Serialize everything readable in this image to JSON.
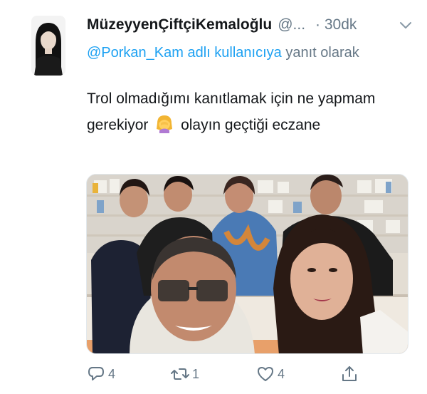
{
  "tweet": {
    "author_name": "MüzeyyenÇiftçiKemaloğlu",
    "handle": "@...",
    "time": "· 30dk",
    "reply_prefix": "@Porkan_Kam adlı kullanıcıya",
    "reply_suffix": " yanıt olarak",
    "text_part1": "Trol olmadığımı kanıtlamak için ne yapmam gerekiyor",
    "text_part2": " olayın geçtiği eczane"
  },
  "actions": {
    "reply_count": "4",
    "retweet_count": "1",
    "like_count": "4"
  },
  "colors": {
    "accent": "#1da1f2",
    "muted": "#657786",
    "text": "#14171a"
  },
  "icons": [
    "chevron-down-icon",
    "woman-facepalming-emoji",
    "reply-icon",
    "retweet-icon",
    "like-icon",
    "share-icon"
  ]
}
